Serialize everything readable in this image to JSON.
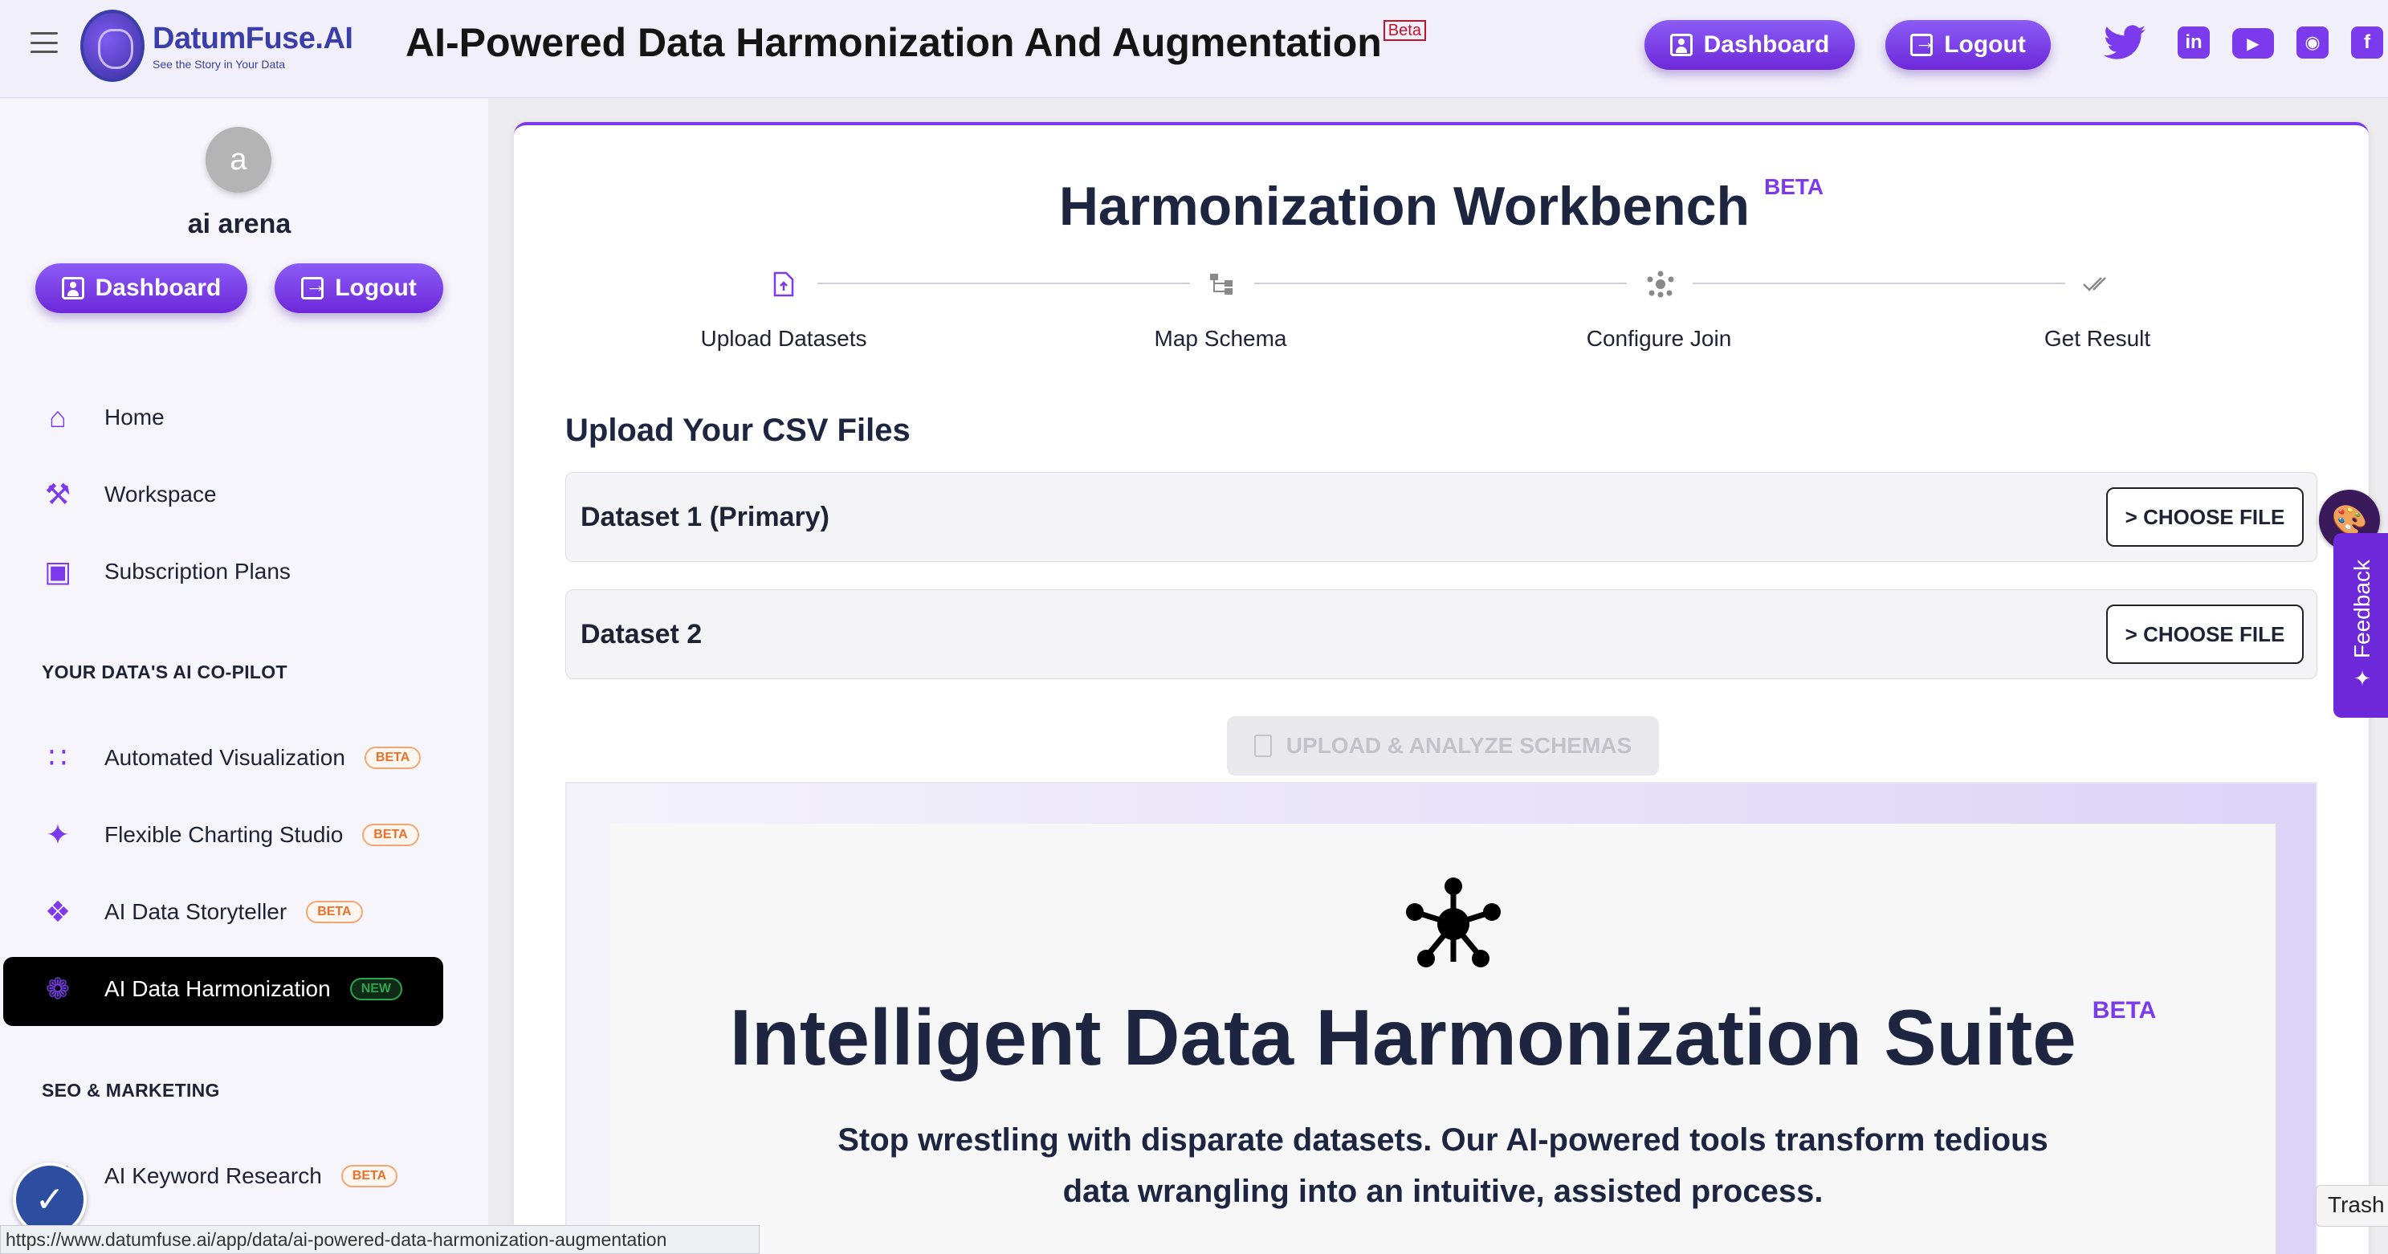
{
  "header": {
    "brand_name": "DatumFuse.AI",
    "brand_tagline": "See the Story in Your Data",
    "page_title": "AI-Powered Data Harmonization And Augmentation",
    "title_badge": "Beta",
    "dashboard_label": "Dashboard",
    "logout_label": "Logout",
    "social_icons": [
      "twitter-icon",
      "linkedin-icon",
      "youtube-icon",
      "instagram-icon",
      "facebook-icon"
    ]
  },
  "sidebar": {
    "avatar_initial": "a",
    "user_name": "ai arena",
    "dashboard_label": "Dashboard",
    "logout_label": "Logout",
    "nav": [
      {
        "label": "Home",
        "icon": "home-icon"
      },
      {
        "label": "Workspace",
        "icon": "tools-icon"
      },
      {
        "label": "Subscription Plans",
        "icon": "monitor-icon"
      }
    ],
    "section_copilot": "YOUR DATA'S AI CO-PILOT",
    "copilot_items": [
      {
        "label": "Automated Visualization",
        "badge": "BETA",
        "icon": "scatter-icon"
      },
      {
        "label": "Flexible Charting Studio",
        "badge": "BETA",
        "icon": "magic-wand-icon"
      },
      {
        "label": "AI Data Storyteller",
        "badge": "BETA",
        "icon": "book-icon"
      },
      {
        "label": "AI Data Harmonization",
        "badge": "NEW",
        "icon": "hub-icon",
        "active": true
      }
    ],
    "section_seo": "SEO & MARKETING",
    "seo_items": [
      {
        "label": "AI Keyword Research",
        "badge": "BETA",
        "icon": "key-icon"
      }
    ]
  },
  "status_url": "https://www.datumfuse.ai/app/data/ai-powered-data-harmonization-augmentation",
  "workbench": {
    "title": "Harmonization Workbench",
    "title_badge": "BETA",
    "steps": [
      {
        "label": "Upload Datasets",
        "icon": "upload-file-icon",
        "active": true
      },
      {
        "label": "Map Schema",
        "icon": "schema-icon",
        "active": false
      },
      {
        "label": "Configure Join",
        "icon": "hub-icon",
        "active": false
      },
      {
        "label": "Get Result",
        "icon": "double-check-icon",
        "active": false
      }
    ],
    "upload_heading": "Upload Your CSV Files",
    "datasets": [
      {
        "label": "Dataset 1 (Primary)",
        "button": "> CHOOSE FILE"
      },
      {
        "label": "Dataset 2",
        "button": "> CHOOSE FILE"
      }
    ],
    "analyze_button": "UPLOAD & ANALYZE SCHEMAS"
  },
  "hero": {
    "title": "Intelligent Data Harmonization Suite",
    "title_badge": "BETA",
    "subtitle": "Stop wrestling with disparate datasets. Our AI-powered tools transform tedious data wrangling into an intuitive, assisted process."
  },
  "widgets": {
    "feedback_label": "Feedback",
    "trash_tooltip": "Trash"
  },
  "colors": {
    "accent": "#7c3aed",
    "active_nav_bg": "#000000",
    "beta_badge": "#e8702a",
    "new_badge": "#2ea44f"
  }
}
